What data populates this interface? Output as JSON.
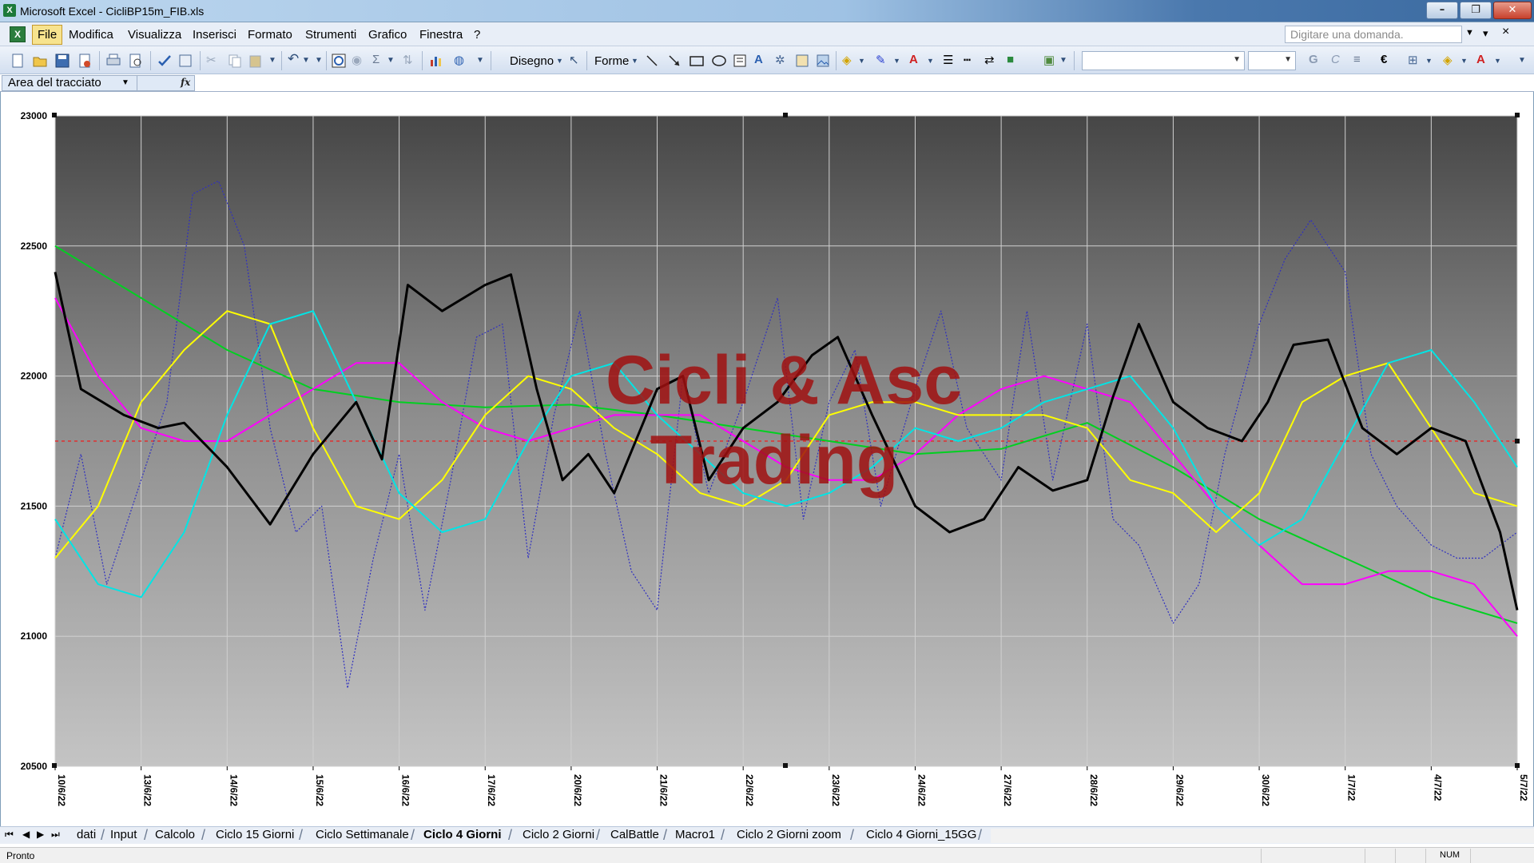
{
  "window": {
    "title": "Microsoft Excel - CicliBP15m_FIB.xls",
    "controls": {
      "minimize": "–",
      "maximize": "❐",
      "close": "✕"
    }
  },
  "menu": {
    "items": [
      "File",
      "Modifica",
      "Visualizza",
      "Inserisci",
      "Formato",
      "Strumenti",
      "Grafico",
      "Finestra",
      "?"
    ],
    "question_placeholder": "Digitare una domanda.",
    "mdi_controls": [
      "▾",
      "×"
    ]
  },
  "toolbar": {
    "drawing_label": "Disegno",
    "shapes_label": "Forme",
    "bold_glyph": "G",
    "italic_glyph": "C",
    "euro_glyph": "€"
  },
  "formula_bar": {
    "name_box": "Area del tracciato",
    "fx": "fx"
  },
  "chart_data": {
    "type": "line",
    "watermark": [
      "Cicli & Asc",
      "Trading"
    ],
    "ylim": [
      20500,
      23000
    ],
    "y_ticks": [
      20500,
      21000,
      21500,
      22000,
      22500,
      23000
    ],
    "x_ticks": [
      "10/6/22",
      "13/6/22",
      "14/6/22",
      "15/6/22",
      "16/6/22",
      "17/6/22",
      "20/6/22",
      "21/6/22",
      "22/6/22",
      "23/6/22",
      "24/6/22",
      "27/6/22",
      "28/6/22",
      "29/6/22",
      "30/6/22",
      "1/7/22",
      "4/7/22",
      "5/7/22"
    ],
    "reference_line": {
      "value": 21750,
      "color": "#e03030"
    },
    "series": [
      {
        "color": "#000000",
        "style": "solid-thick",
        "x": [
          0,
          0.3,
          0.8,
          1.2,
          1.5,
          2.0,
          2.5,
          3.0,
          3.5,
          3.8,
          4.1,
          4.5,
          5.0,
          5.3,
          5.6,
          5.9,
          6.2,
          6.5,
          7.0,
          7.3,
          7.6,
          8.0,
          8.4,
          8.8,
          9.1,
          9.5,
          10.0,
          10.4,
          10.8,
          11.2,
          11.6,
          12.0,
          12.3,
          12.6,
          13.0,
          13.4,
          13.8,
          14.1,
          14.4,
          14.8,
          15.2,
          15.6,
          16.0,
          16.4,
          16.8,
          17.0
        ],
        "y": [
          22400,
          21950,
          21850,
          21800,
          21820,
          21650,
          21430,
          21700,
          21900,
          21680,
          22350,
          22250,
          22350,
          22390,
          21950,
          21600,
          21700,
          21550,
          21950,
          22000,
          21600,
          21800,
          21900,
          22080,
          22150,
          21850,
          21500,
          21400,
          21450,
          21650,
          21560,
          21600,
          21920,
          22200,
          21900,
          21800,
          21750,
          21900,
          22120,
          22140,
          21800,
          21700,
          21800,
          21750,
          21400,
          21100
        ]
      },
      {
        "color": "#3030c0",
        "style": "dotted-thin",
        "x": [
          0,
          0.3,
          0.6,
          1.0,
          1.3,
          1.6,
          1.9,
          2.2,
          2.5,
          2.8,
          3.1,
          3.4,
          3.7,
          4.0,
          4.3,
          4.6,
          4.9,
          5.2,
          5.5,
          5.8,
          6.1,
          6.4,
          6.7,
          7.0,
          7.3,
          7.6,
          8.0,
          8.4,
          8.7,
          9.0,
          9.3,
          9.6,
          10.0,
          10.3,
          10.6,
          11.0,
          11.3,
          11.6,
          12.0,
          12.3,
          12.6,
          13.0,
          13.3,
          13.6,
          14.0,
          14.3,
          14.6,
          15.0,
          15.3,
          15.6,
          16.0,
          16.3,
          16.6,
          17.0
        ],
        "y": [
          21300,
          21700,
          21200,
          21600,
          21900,
          22700,
          22750,
          22500,
          21800,
          21400,
          21500,
          20800,
          21300,
          21700,
          21100,
          21600,
          22150,
          22200,
          21300,
          21850,
          22250,
          21700,
          21250,
          21100,
          22000,
          21550,
          21900,
          22300,
          21450,
          21900,
          22100,
          21500,
          21950,
          22250,
          21800,
          21600,
          22250,
          21600,
          22200,
          21450,
          21350,
          21050,
          21200,
          21700,
          22200,
          22450,
          22600,
          22400,
          21700,
          21500,
          21350,
          21300,
          21300,
          21400
        ]
      },
      {
        "color": "#00d020",
        "style": "solid",
        "x": [
          0,
          1.0,
          2.0,
          3.0,
          4.0,
          5.0,
          6.0,
          7.0,
          8.0,
          9.0,
          10.0,
          11.0,
          12.0,
          13.0,
          14.0,
          15.0,
          16.0,
          17.0
        ],
        "y": [
          22500,
          22300,
          22100,
          21950,
          21900,
          21880,
          21890,
          21850,
          21800,
          21750,
          21700,
          21720,
          21820,
          21650,
          21450,
          21300,
          21150,
          21050
        ]
      },
      {
        "color": "#ff00ff",
        "style": "solid",
        "x": [
          0,
          0.5,
          1.0,
          1.5,
          2.0,
          2.5,
          3.0,
          3.5,
          4.0,
          4.5,
          5.0,
          5.5,
          6.0,
          6.5,
          7.0,
          7.5,
          8.0,
          8.5,
          9.0,
          9.5,
          10.0,
          10.5,
          11.0,
          11.5,
          12.0,
          12.5,
          13.0,
          13.5,
          14.0,
          14.5,
          15.0,
          15.5,
          16.0,
          16.5,
          17.0
        ],
        "y": [
          22300,
          22000,
          21800,
          21750,
          21750,
          21850,
          21950,
          22050,
          22050,
          21900,
          21800,
          21750,
          21800,
          21850,
          21850,
          21850,
          21750,
          21650,
          21600,
          21600,
          21700,
          21850,
          21950,
          22000,
          21950,
          21900,
          21700,
          21500,
          21350,
          21200,
          21200,
          21250,
          21250,
          21200,
          21000
        ]
      },
      {
        "color": "#ffff00",
        "style": "solid",
        "x": [
          0,
          0.5,
          1.0,
          1.5,
          2.0,
          2.5,
          3.0,
          3.5,
          4.0,
          4.5,
          5.0,
          5.5,
          6.0,
          6.5,
          7.0,
          7.5,
          8.0,
          8.5,
          9.0,
          9.5,
          10.0,
          10.5,
          11.0,
          11.5,
          12.0,
          12.5,
          13.0,
          13.5,
          14.0,
          14.5,
          15.0,
          15.5,
          16.0,
          16.5,
          17.0
        ],
        "y": [
          21300,
          21500,
          21900,
          22100,
          22250,
          22200,
          21800,
          21500,
          21450,
          21600,
          21850,
          22000,
          21950,
          21800,
          21700,
          21550,
          21500,
          21600,
          21850,
          21900,
          21900,
          21850,
          21850,
          21850,
          21800,
          21600,
          21550,
          21400,
          21550,
          21900,
          22000,
          22050,
          21800,
          21550,
          21500
        ]
      },
      {
        "color": "#00e5e5",
        "style": "solid",
        "x": [
          0,
          0.5,
          1.0,
          1.5,
          2.0,
          2.5,
          3.0,
          3.5,
          4.0,
          4.5,
          5.0,
          5.5,
          6.0,
          6.5,
          7.0,
          7.5,
          8.0,
          8.5,
          9.0,
          9.5,
          10.0,
          10.5,
          11.0,
          11.5,
          12.0,
          12.5,
          13.0,
          13.5,
          14.0,
          14.5,
          15.0,
          15.5,
          16.0,
          16.5,
          17.0
        ],
        "y": [
          21450,
          21200,
          21150,
          21400,
          21850,
          22200,
          22250,
          21900,
          21550,
          21400,
          21450,
          21750,
          22000,
          22050,
          21850,
          21700,
          21550,
          21500,
          21550,
          21650,
          21800,
          21750,
          21800,
          21900,
          21950,
          22000,
          21800,
          21500,
          21350,
          21450,
          21750,
          22050,
          22100,
          21900,
          21650
        ]
      }
    ]
  },
  "sheet_tabs": {
    "nav": [
      "⏮",
      "◀",
      "▶",
      "⏭"
    ],
    "tabs": [
      "dati",
      "Input",
      "Calcolo",
      "Ciclo 15 Giorni",
      "Ciclo Settimanale",
      "Ciclo 4 Giorni",
      "Ciclo 2 Giorni",
      "CalBattle",
      "Macro1",
      "Ciclo 2 Giorni zoom",
      "Ciclo 4 Giorni_15GG"
    ],
    "active": "Ciclo 4 Giorni"
  },
  "status": {
    "text": "Pronto",
    "num": "NUM"
  }
}
